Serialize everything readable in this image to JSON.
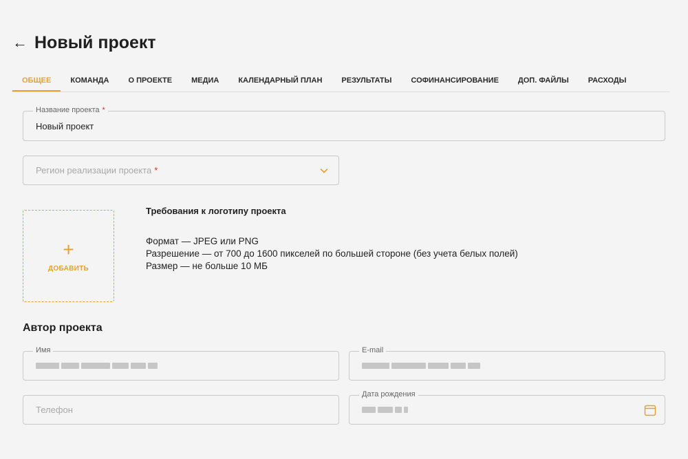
{
  "header": {
    "back_icon": "←",
    "title": "Новый проект"
  },
  "tabs": [
    {
      "label": "Общее",
      "active": true
    },
    {
      "label": "Команда"
    },
    {
      "label": "О проекте"
    },
    {
      "label": "Медиа"
    },
    {
      "label": "Календарный план"
    },
    {
      "label": "Результаты"
    },
    {
      "label": "Софинансирование"
    },
    {
      "label": "Доп. файлы"
    },
    {
      "label": "Расходы"
    }
  ],
  "project_name": {
    "label": "Название проекта",
    "value": "Новый проект",
    "required_mark": "*"
  },
  "region": {
    "placeholder": "Регион реализации проекта",
    "required_mark": "*"
  },
  "logo": {
    "plus_icon": "+",
    "add_label": "ДОБАВИТЬ",
    "requirements_title": "Требования к логотипу проекта",
    "requirements": [
      "Формат — JPEG или PNG",
      "Разрешение — от 700 до 1600 пикселей по большей стороне (без учета белых полей)",
      "Размер — не больше 10 МБ"
    ]
  },
  "author": {
    "title": "Автор проекта",
    "name": {
      "label": "Имя"
    },
    "email": {
      "label": "E-mail"
    },
    "phone": {
      "placeholder": "Телефон"
    },
    "birth_date": {
      "label": "Дата рождения"
    }
  },
  "colors": {
    "accent": "#e6a133",
    "required": "#d93025",
    "background": "#f4f4f4"
  }
}
